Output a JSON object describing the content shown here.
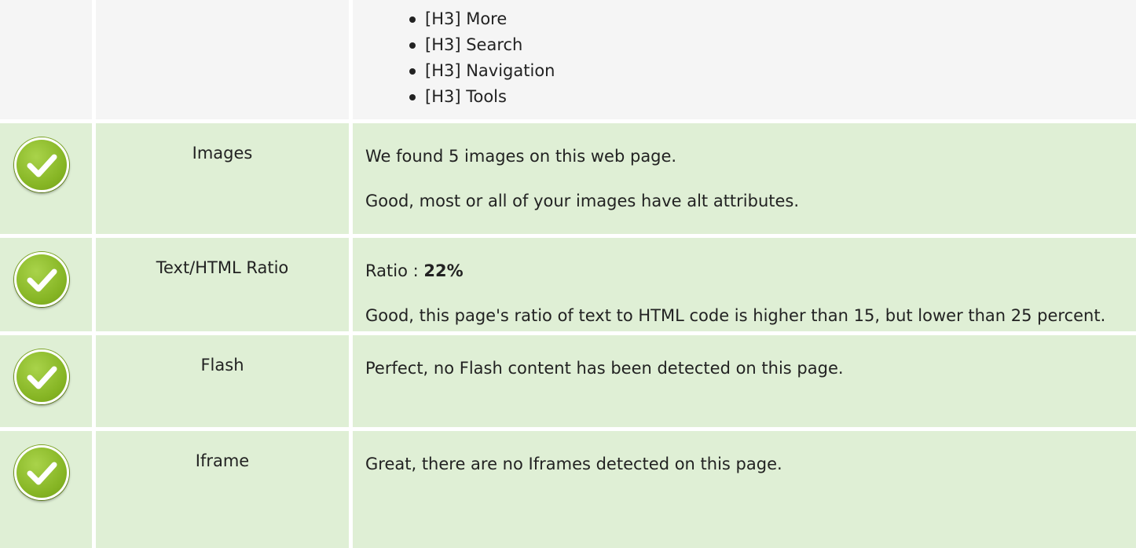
{
  "headings": {
    "items": [
      "[H3] More",
      "[H3] Search",
      "[H3] Navigation",
      "[H3] Tools"
    ]
  },
  "checks": {
    "images": {
      "label": "Images",
      "status": "pass",
      "line1": "We found 5 images on this web page.",
      "line2": "Good, most or all of your images have alt attributes."
    },
    "ratio": {
      "label": "Text/HTML Ratio",
      "status": "pass",
      "prefix": "Ratio : ",
      "value": "22%",
      "line2": "Good, this page's ratio of text to HTML code is higher than 15, but lower than 25 percent."
    },
    "flash": {
      "label": "Flash",
      "status": "pass",
      "line1": "Perfect, no Flash content has been detected on this page."
    },
    "iframe": {
      "label": "Iframe",
      "status": "pass",
      "line1": "Great, there are no Iframes detected on this page."
    }
  },
  "colors": {
    "pass_row_bg": "#dfefd5",
    "neutral_row_bg": "#f5f5f5",
    "badge_green": "#86b524"
  },
  "icons": {
    "status_pass": "check-circle-icon",
    "list_bullet": "bullet-icon"
  }
}
